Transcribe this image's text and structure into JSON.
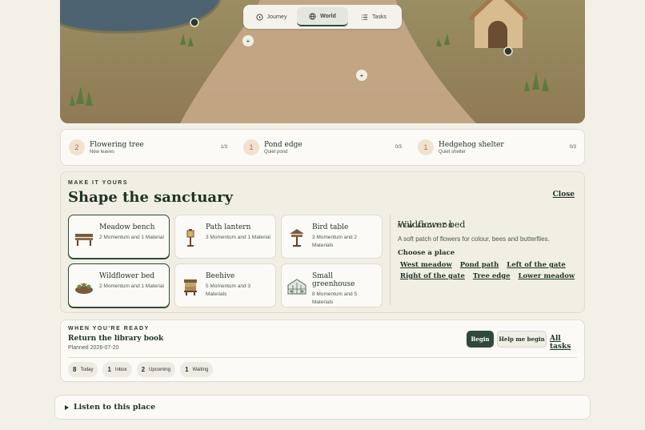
{
  "nav": {
    "tabs": [
      {
        "label": "Journey",
        "icon": "compass-icon"
      },
      {
        "label": "World",
        "icon": "globe-icon",
        "active": true
      },
      {
        "label": "Tasks",
        "icon": "list-icon"
      }
    ]
  },
  "scene": {
    "markers": [
      "+",
      "+"
    ]
  },
  "goals": [
    {
      "num": "2",
      "title": "Flowering tree",
      "sub": "New leaves",
      "count": "1/3"
    },
    {
      "num": "1",
      "title": "Pond edge",
      "sub": "Quiet pond",
      "count": "0/3"
    },
    {
      "num": "1",
      "title": "Hedgehog shelter",
      "sub": "Quiet shelter",
      "count": "0/3"
    }
  ],
  "builder": {
    "eyebrow": "MAKE IT YOURS",
    "title": "Shape the sanctuary",
    "close": "Close",
    "items": [
      {
        "title": "Meadow bench",
        "desc": "2 Momentum and 1 Material",
        "icon": "bench-icon",
        "selected": true
      },
      {
        "title": "Path lantern",
        "desc": "3 Momentum and 1 Material",
        "icon": "lantern-icon"
      },
      {
        "title": "Bird table",
        "desc": "3 Momentum and 2 Materials",
        "icon": "bird-table-icon"
      },
      {
        "title": "Wildflower bed",
        "desc": "2 Momentum and 1 Material",
        "icon": "flower-bed-icon",
        "selected": true
      },
      {
        "title": "Beehive",
        "desc": "5 Momentum and 3 Materials",
        "icon": "beehive-icon"
      },
      {
        "title": "Small greenhouse",
        "desc": "8 Momentum and 5 Materials",
        "icon": "greenhouse-icon"
      }
    ],
    "addition": {
      "eyebrow": "NEW ADDITION",
      "name": "Wildflower bed",
      "desc": "A soft patch of flowers for colour, bees and butterflies.",
      "choose": "Choose a place",
      "places": [
        "West meadow",
        "Pond path",
        "Left of the gate",
        "Right of the gate",
        "Tree edge",
        "Lower meadow"
      ]
    }
  },
  "ready": {
    "eyebrow": "WHEN YOU'RE READY",
    "title": "Return the library book",
    "date": "Planned 2026-07-20",
    "begin": "Begin",
    "help": "Help me begin",
    "all_tasks": "All tasks",
    "chips": [
      {
        "num": "8",
        "label": "Today"
      },
      {
        "num": "1",
        "label": "Inbox"
      },
      {
        "num": "2",
        "label": "Upcoming"
      },
      {
        "num": "1",
        "label": "Waiting"
      }
    ]
  },
  "listen": {
    "label": "Listen to this place"
  }
}
